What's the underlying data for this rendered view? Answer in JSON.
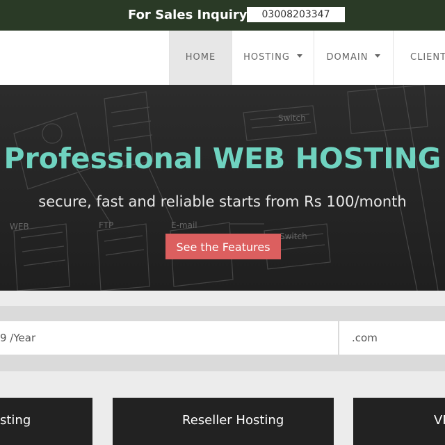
{
  "topbar": {
    "label": "For Sales Inquiry",
    "phone": "03008203347"
  },
  "nav": {
    "items": [
      "HOME",
      "HOSTING",
      "DOMAIN",
      "CLIENT"
    ]
  },
  "hero": {
    "title": "Professional WEB HOSTING",
    "subtitle": "secure, fast and reliable starts from Rs 100/month",
    "button": "See the Features",
    "sketch_labels": [
      "Switch",
      "WEB",
      "FTP",
      "E-mail",
      "Switch"
    ]
  },
  "search": {
    "price_text": "9 /Year",
    "tld": ".com"
  },
  "plans": [
    "sting",
    "Reseller Hosting",
    "VP"
  ]
}
